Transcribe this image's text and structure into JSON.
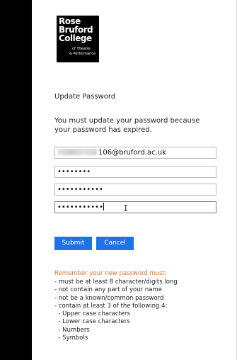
{
  "logo": {
    "line1": "Rose",
    "line2": "Bruford",
    "line3": "College",
    "line4": "of Theatre",
    "line5": "& Performance"
  },
  "heading": "Update Password",
  "message": "You must update your password because your password has expired.",
  "form": {
    "email_suffix": "106@bruford.ac.uk",
    "old_password_mask": "••••••••",
    "new_password_mask": "•••••••••••",
    "confirm_password_mask": "•••••••••••"
  },
  "buttons": {
    "submit": "Submit",
    "cancel": "Cancel"
  },
  "rules": {
    "title": "Remember your new password must:",
    "items": [
      "- must be at least 8 character/digits long",
      "- not contain any part of your name",
      "- not be a known/common password",
      "- contain at least 3 of the following 4:",
      "  - Upper case characters",
      "  - Lower case characters",
      "  - Numbers",
      "  - Symbols"
    ]
  },
  "colors": {
    "button_blue": "#1e73e8",
    "rules_title_orange": "#e8702a",
    "sidebar_black": "#000000"
  },
  "icons": {
    "cursor": "text-cursor-icon"
  }
}
